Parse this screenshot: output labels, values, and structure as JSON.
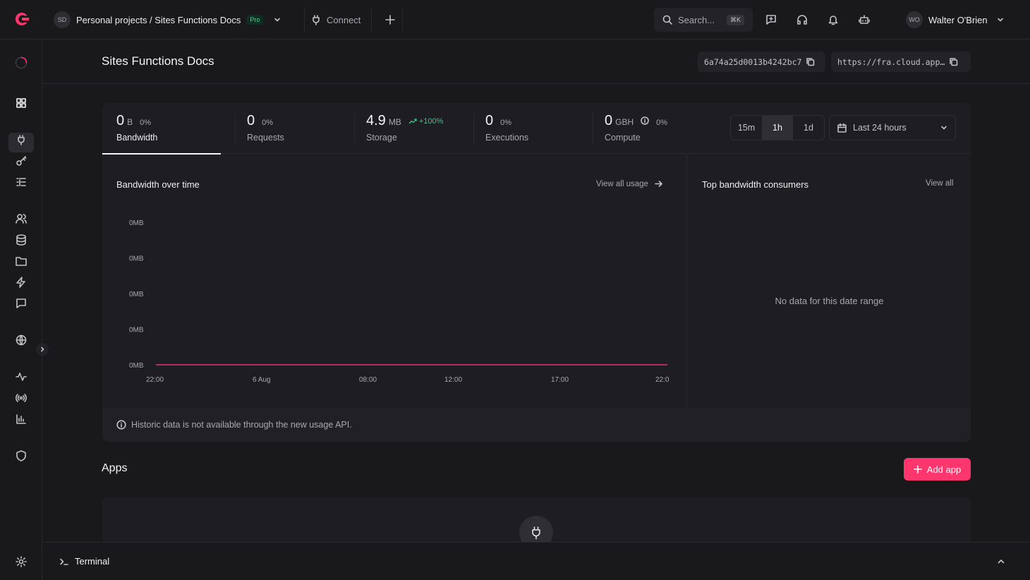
{
  "topbar": {
    "project_avatar": "SD",
    "project_path": "Personal projects / Sites Functions Docs",
    "plan_badge": "Pro",
    "connect_label": "Connect",
    "search_placeholder": "Search...",
    "search_shortcut": "⌘K",
    "user_avatar": "WO",
    "user_name": "Walter O'Brien"
  },
  "header": {
    "title": "Sites Functions Docs",
    "project_id": "6a74a25d0013b4242bc7",
    "endpoint": "https://fra.cloud.app…"
  },
  "metrics": [
    {
      "value": "0",
      "unit": "B",
      "change": "0%",
      "label": "Bandwidth"
    },
    {
      "value": "0",
      "unit": "",
      "change": "0%",
      "label": "Requests"
    },
    {
      "value": "4.9",
      "unit": "MB",
      "change": "+100%",
      "label": "Storage"
    },
    {
      "value": "0",
      "unit": "",
      "change": "0%",
      "label": "Executions"
    },
    {
      "value": "0",
      "unit": "GBH",
      "change": "0%",
      "label": "Compute"
    }
  ],
  "range": {
    "options": [
      "15m",
      "1h",
      "1d"
    ],
    "selected": "1h",
    "date_range": "Last 24 hours"
  },
  "bandwidth_chart": {
    "title": "Bandwidth over time",
    "view_all": "View all usage"
  },
  "top_consumers": {
    "title": "Top bandwidth consumers",
    "view_all": "View all",
    "empty": "No data for this date range"
  },
  "footer_note": "Historic data is not available through the new usage API.",
  "apps": {
    "title": "Apps",
    "add_label": "Add app"
  },
  "terminal": {
    "label": "Terminal"
  },
  "colors": {
    "accent": "#fd366e",
    "line": "#e6357a",
    "trend": "#3ec48a"
  },
  "chart_data": {
    "type": "line",
    "title": "Bandwidth over time",
    "x_ticks": [
      "22:00",
      "6 Aug",
      "08:00",
      "12:00",
      "17:00",
      "22:0"
    ],
    "y_ticks": [
      "0MB",
      "0MB",
      "0MB",
      "0MB",
      "0MB"
    ],
    "series": [
      {
        "values": [
          0,
          0,
          0,
          0,
          0,
          0
        ]
      }
    ],
    "ylim": [
      0,
      0
    ],
    "grid": false
  }
}
